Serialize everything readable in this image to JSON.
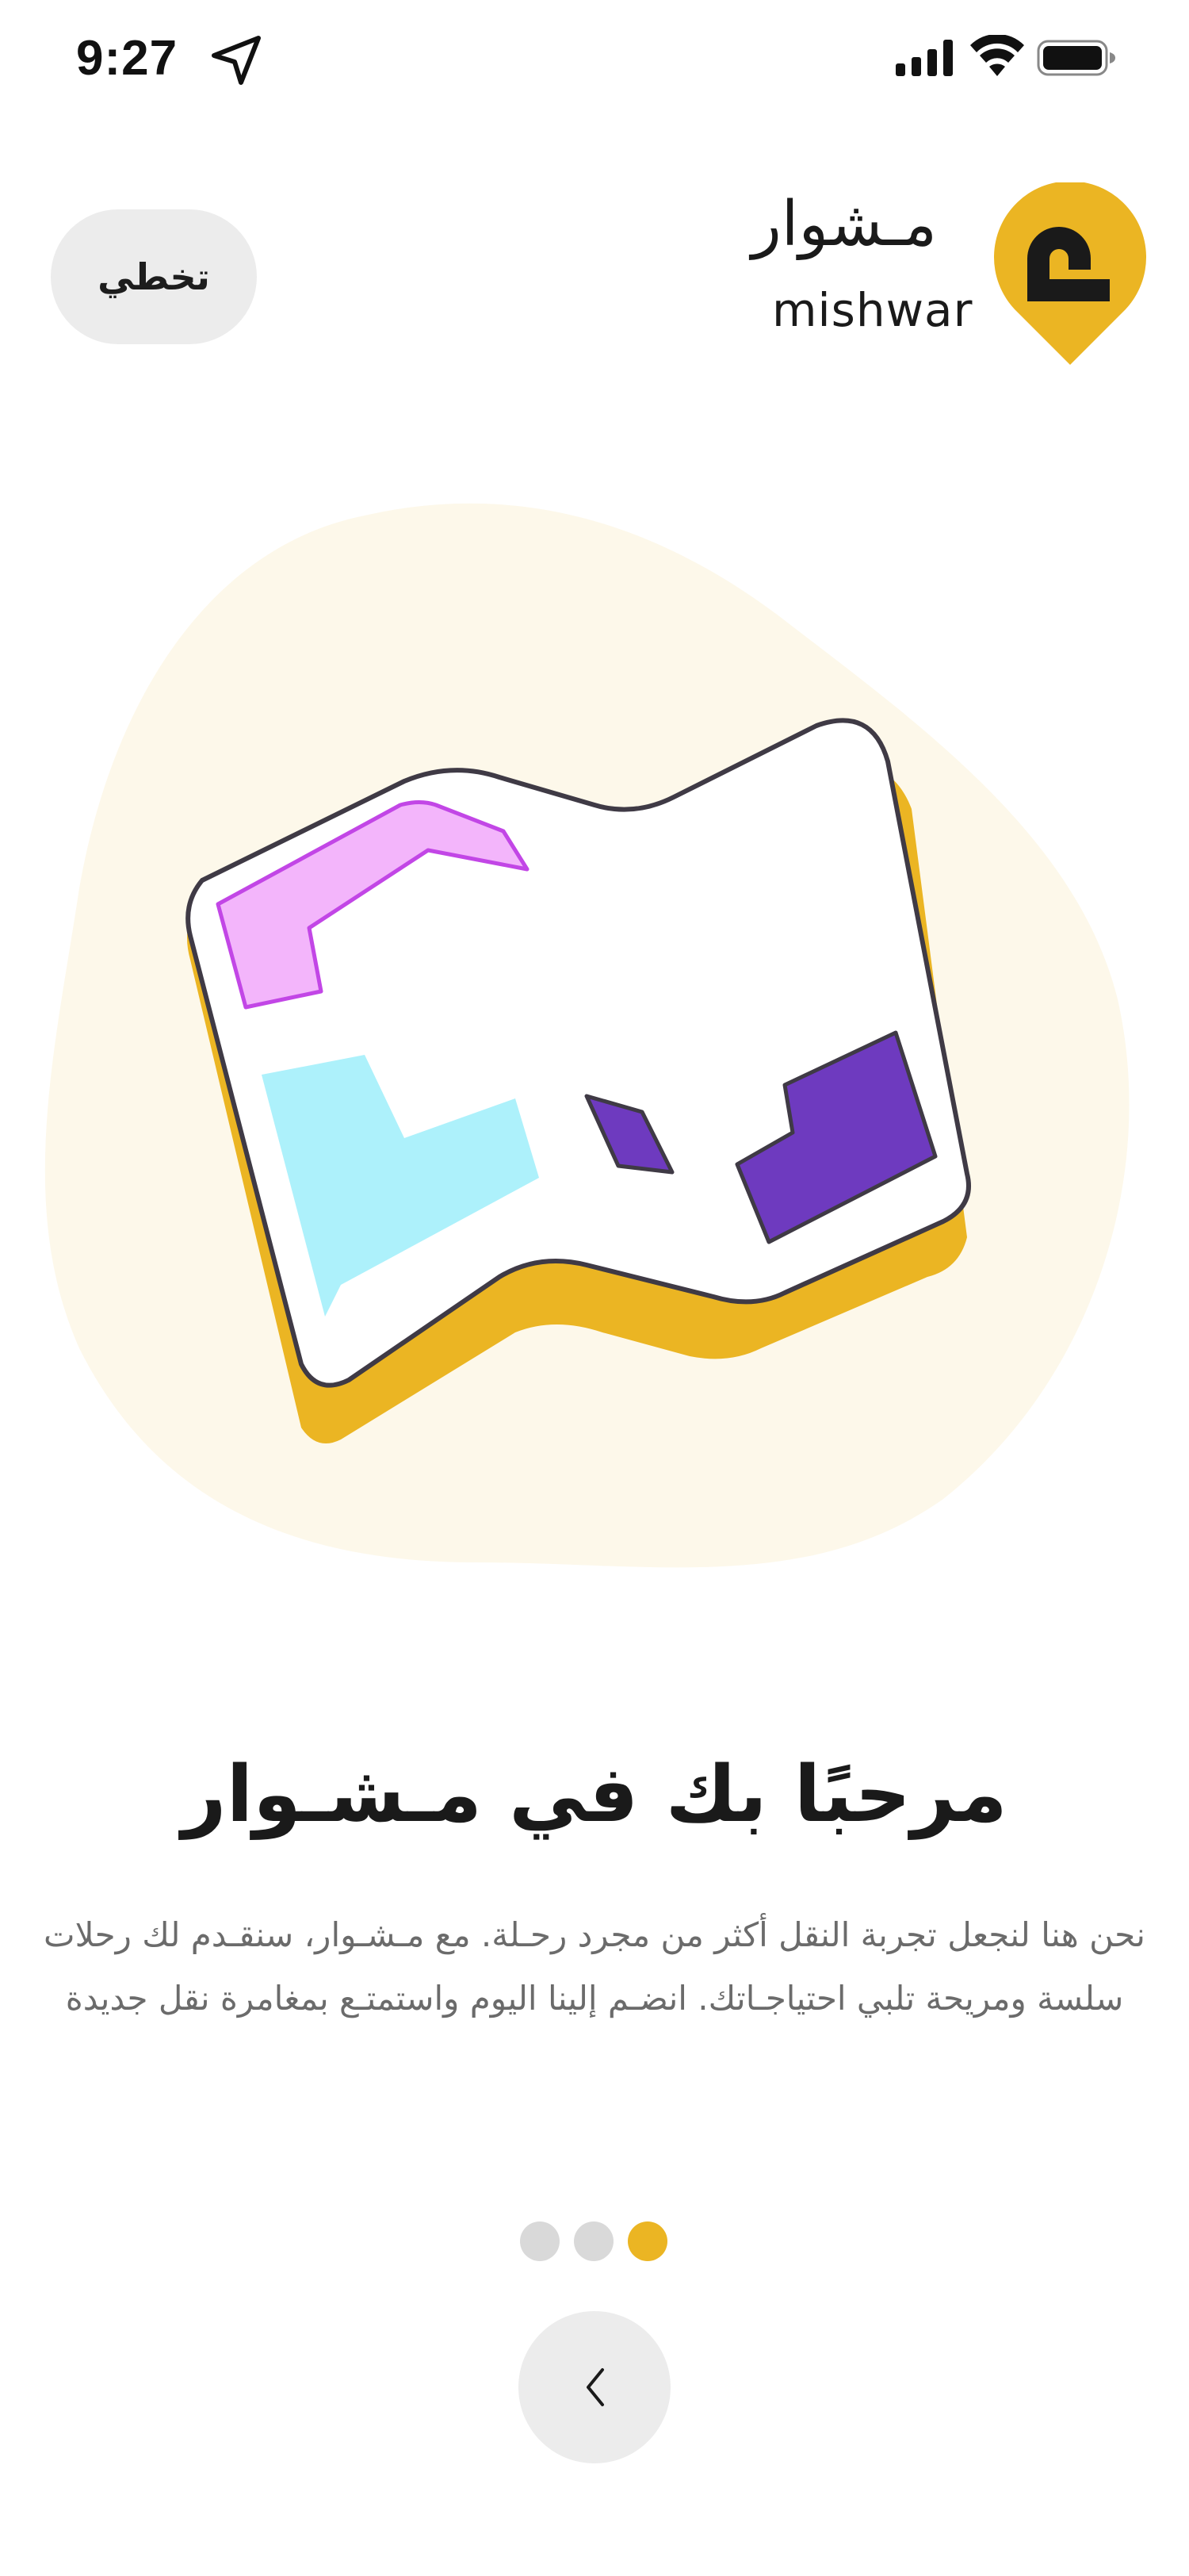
{
  "status_bar": {
    "time": "9:27",
    "icons": [
      "location-arrow-icon",
      "cellular-signal-icon",
      "wifi-icon",
      "battery-icon"
    ]
  },
  "header": {
    "skip_label": "تخطي",
    "logo": {
      "text_ar": "مـشوار",
      "text_en": "mishwar"
    }
  },
  "content": {
    "title": "مرحبًا بك في مـشـوار",
    "description": "نحن هنا لنجعل تجربة النقل أكثر من مجرد رحـلة. مع مـشـوار، سنقـدم لك رحلات سلسة ومريحة تلبي احتياجـاتك. انضـم إلينا اليوم واستمتـع بمغامرة نقل جديدة"
  },
  "pagination": {
    "total": 3,
    "active_index": 2
  },
  "navigation": {
    "next_icon": "chevron-left-icon"
  },
  "colors": {
    "brand_yellow": "#EBB523",
    "blob_background": "#FDF8EA",
    "map_pink": "#F3B5FB",
    "map_pink_stroke": "#C246E6",
    "map_cyan": "#ADF1FB",
    "map_purple": "#6E3ABF",
    "button_grey": "#ECECEC",
    "dot_inactive": "#D9D9D9"
  }
}
